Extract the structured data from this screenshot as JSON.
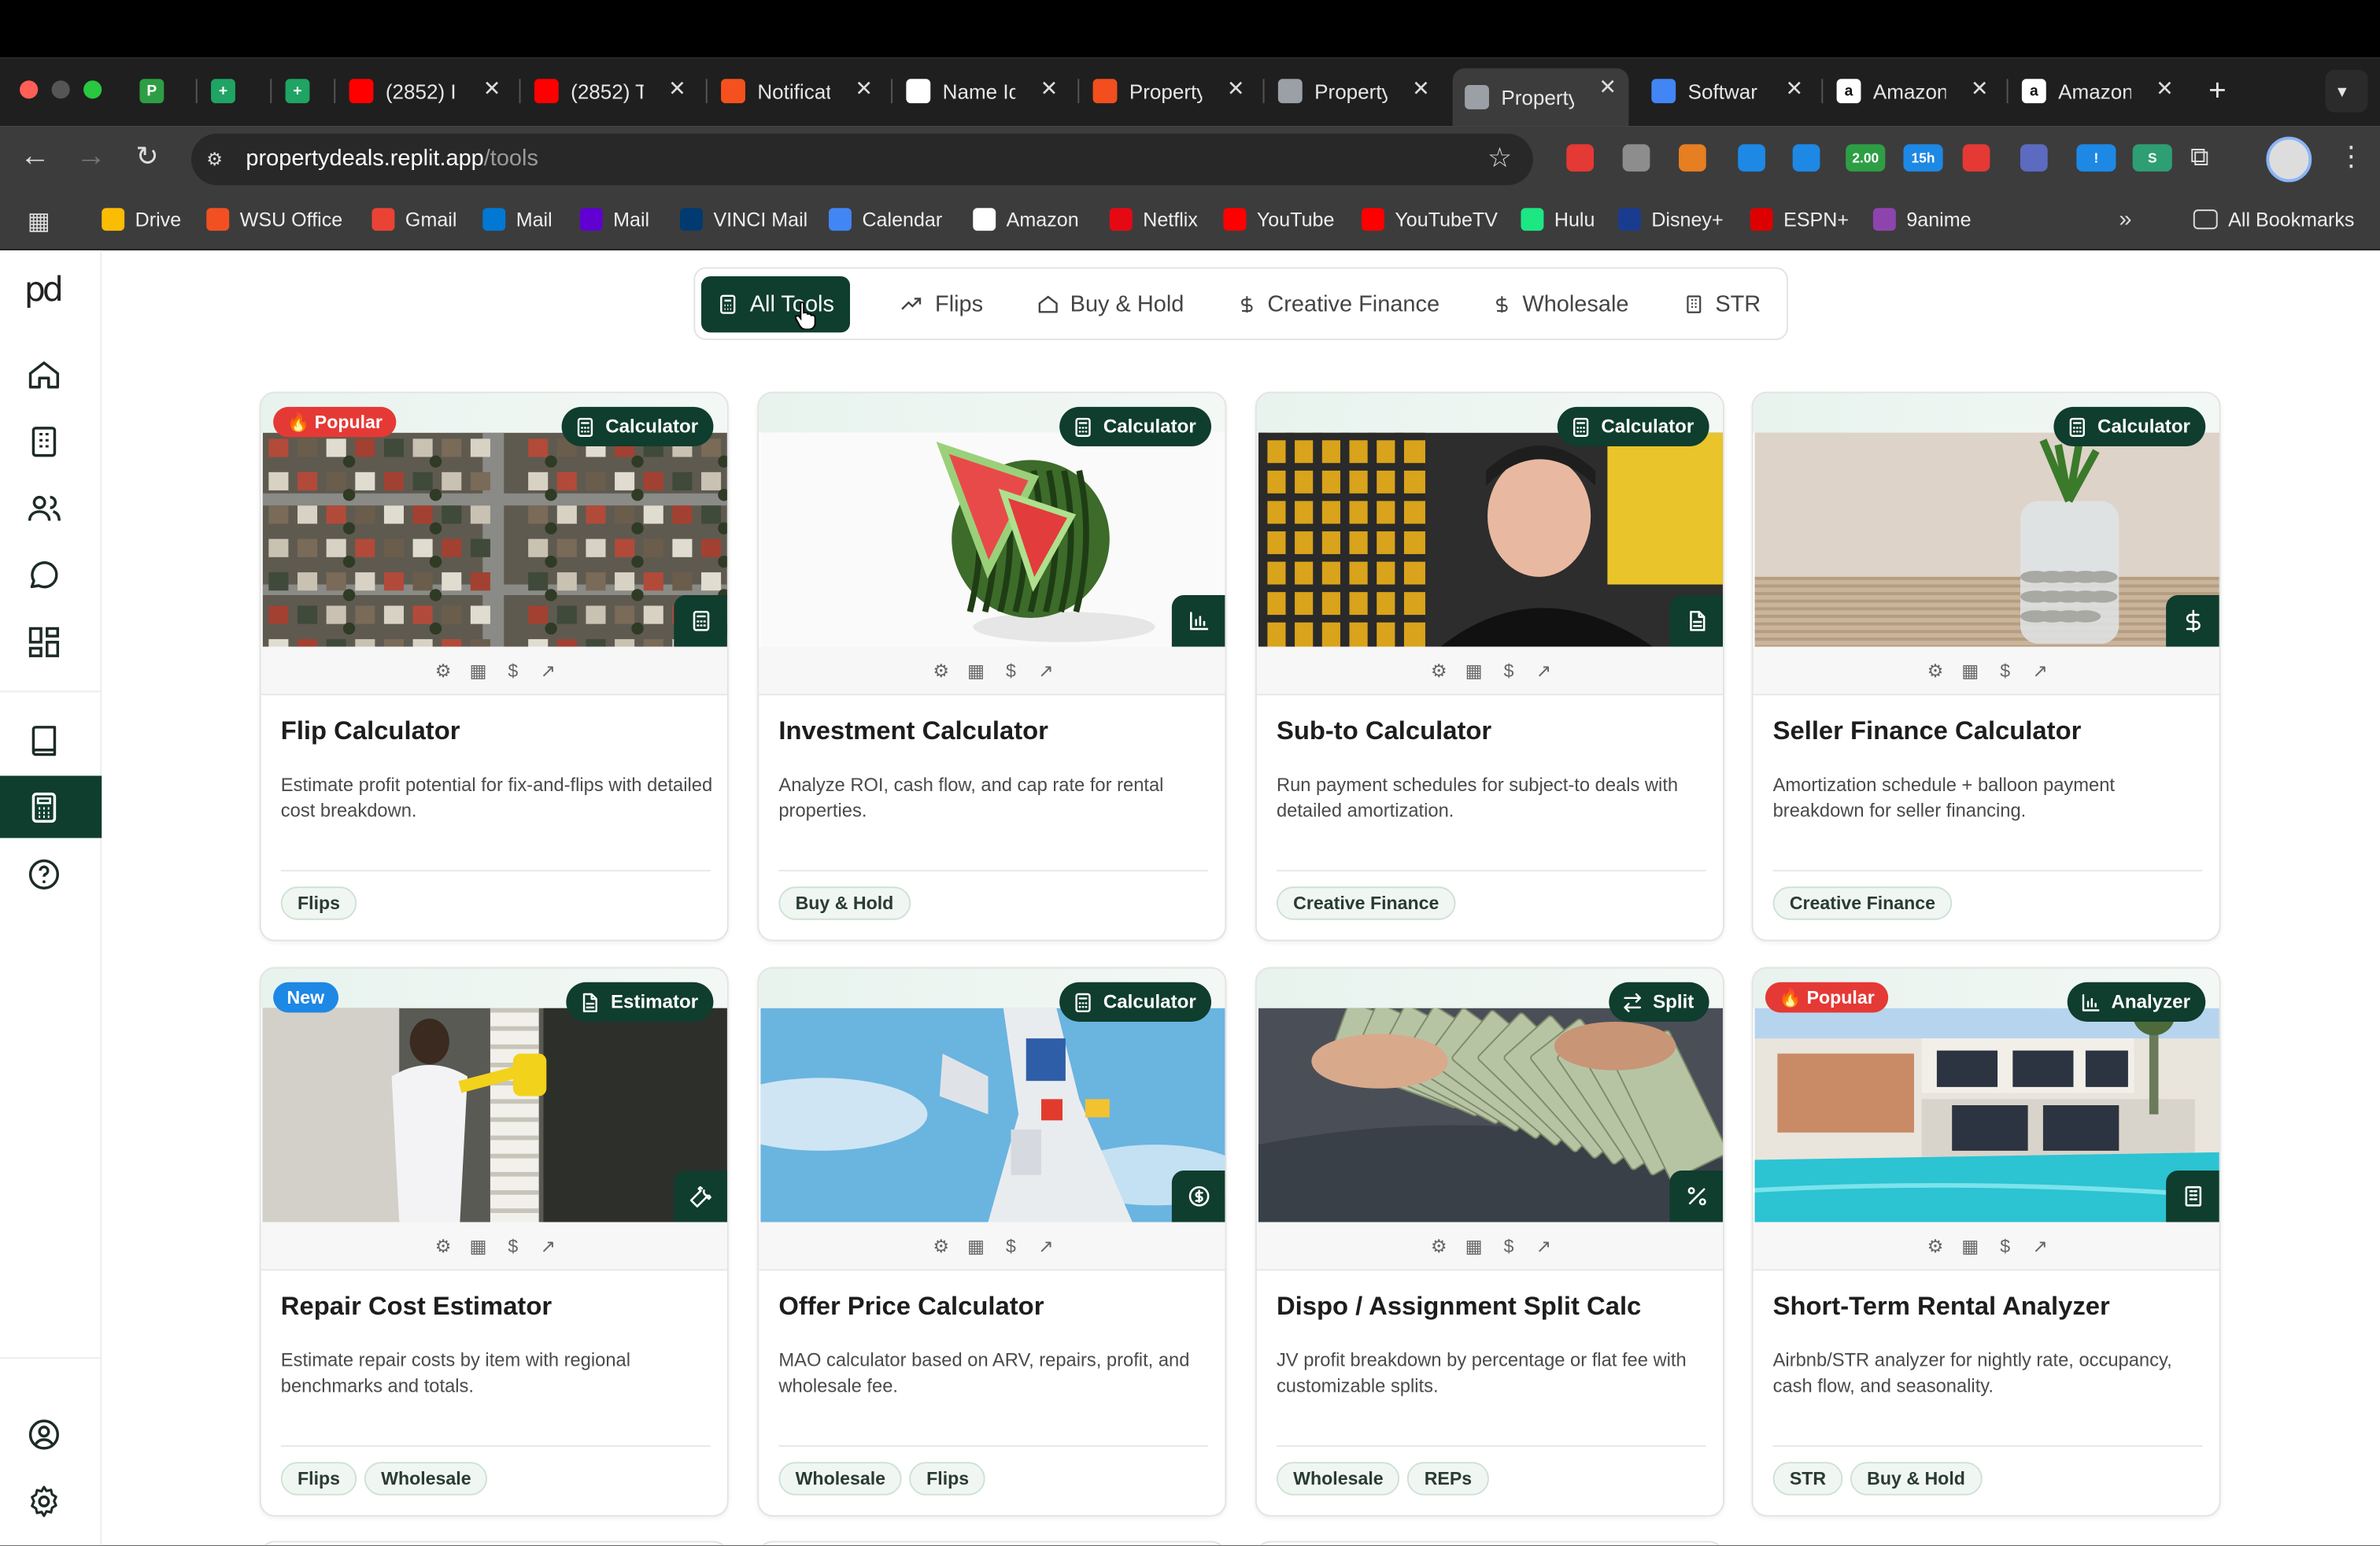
{
  "browser": {
    "tabs": [
      {
        "label": "",
        "favicon": "P",
        "color": "#2e9e44"
      },
      {
        "label": "",
        "favicon": "+",
        "color": "#1fa463"
      },
      {
        "label": "",
        "favicon": "+",
        "color": "#1fa463"
      },
      {
        "label": "(2852) I",
        "favicon": "youtube-icon",
        "color": "#ff0000"
      },
      {
        "label": "(2852) T",
        "favicon": "youtube-icon",
        "color": "#ff0000"
      },
      {
        "label": "Notificat",
        "favicon": "bell-icon",
        "color": "#f4511e"
      },
      {
        "label": "Name Id",
        "favicon": "openai-icon",
        "color": "#ffffff"
      },
      {
        "label": "Property",
        "favicon": "figma-icon",
        "color": "#f24e1e"
      },
      {
        "label": "Property",
        "favicon": "globe-icon",
        "color": "#9aa0a6"
      },
      {
        "label": "Property",
        "favicon": "globe-icon",
        "color": "#9aa0a6"
      },
      {
        "label": "Softwar",
        "favicon": "docs-icon",
        "color": "#4285f4"
      },
      {
        "label": "Amazon",
        "favicon": "a",
        "color": "#ffffff"
      },
      {
        "label": "Amazon",
        "favicon": "a",
        "color": "#ffffff"
      }
    ],
    "url_host": "propertydeals.replit.app",
    "url_path": "/tools",
    "extensions": [
      {
        "label": "",
        "color": "#e53935"
      },
      {
        "label": "",
        "color": "#8d8d8d"
      },
      {
        "label": "",
        "color": "#e67e22"
      },
      {
        "label": "",
        "color": "#1e88e5"
      },
      {
        "label": "",
        "color": "#1e88e5"
      },
      {
        "label": "2.00",
        "color": "#2e9e44"
      },
      {
        "label": "15h",
        "color": "#1e88e5"
      },
      {
        "label": "",
        "color": "#e53935"
      },
      {
        "label": "",
        "color": "#5c6bc0"
      },
      {
        "label": "!",
        "color": "#1e88e5"
      },
      {
        "label": "S",
        "color": "#2e9e74"
      }
    ],
    "bookmarks": [
      {
        "label": "Drive",
        "icon": "drive-icon",
        "color": "#fbbc04"
      },
      {
        "label": "WSU Office",
        "icon": "office-icon",
        "color": "#f25022"
      },
      {
        "label": "Gmail",
        "icon": "gmail-icon",
        "color": "#ea4335"
      },
      {
        "label": "Mail",
        "icon": "outlook-icon",
        "color": "#0078d4"
      },
      {
        "label": "Mail",
        "icon": "yahoo-icon",
        "color": "#6001d2"
      },
      {
        "label": "VINCI Mail",
        "icon": "vinci-icon",
        "color": "#003a70"
      },
      {
        "label": "Calendar",
        "icon": "calendar-icon",
        "color": "#4285f4"
      },
      {
        "label": "Amazon",
        "icon": "amazon-icon",
        "color": "#ffffff"
      },
      {
        "label": "Netflix",
        "icon": "netflix-icon",
        "color": "#e50914"
      },
      {
        "label": "YouTube",
        "icon": "youtube-icon",
        "color": "#ff0000"
      },
      {
        "label": "YouTubeTV",
        "icon": "youtubetv-icon",
        "color": "#ff0000"
      },
      {
        "label": "Hulu",
        "icon": "hulu-icon",
        "color": "#1ce783"
      },
      {
        "label": "Disney+",
        "icon": "disney-icon",
        "color": "#1a3c8f"
      },
      {
        "label": "ESPN+",
        "icon": "espn-icon",
        "color": "#d00"
      },
      {
        "label": "9anime",
        "icon": "anime-icon",
        "color": "#8e44ad"
      }
    ],
    "all_bookmarks": "All Bookmarks"
  },
  "app": {
    "logo": "pd",
    "filters": [
      {
        "label": "All Tools",
        "icon": "calculator-icon"
      },
      {
        "label": "Flips",
        "icon": "trend-icon"
      },
      {
        "label": "Buy & Hold",
        "icon": "home-icon"
      },
      {
        "label": "Creative Finance",
        "icon": "dollar-icon"
      },
      {
        "label": "Wholesale",
        "icon": "dollar-icon"
      },
      {
        "label": "STR",
        "icon": "building-icon"
      }
    ],
    "strip_icons": [
      "⚙",
      "▦",
      "$",
      "↗"
    ],
    "cards": [
      {
        "title": "Flip Calculator",
        "desc": "Estimate profit potential for fix-and-flips with detailed cost breakdown.",
        "pill": "Calculator",
        "pill_icon": "calculator-icon",
        "badge": "🔥 Popular",
        "badge_type": "popular",
        "corner_icon": "calculator-icon",
        "tags": [
          "Flips"
        ],
        "image": "aerial-neighborhood"
      },
      {
        "title": "Investment Calculator",
        "desc": "Analyze ROI, cash flow, and cap rate for rental properties.",
        "pill": "Calculator",
        "pill_icon": "calculator-icon",
        "badge": "",
        "badge_type": "",
        "corner_icon": "bar-chart-icon",
        "tags": [
          "Buy & Hold"
        ],
        "image": "watermelon"
      },
      {
        "title": "Sub-to Calculator",
        "desc": "Run payment schedules for subject-to deals with detailed amortization.",
        "pill": "Calculator",
        "pill_icon": "calculator-icon",
        "badge": "",
        "badge_type": "",
        "corner_icon": "document-icon",
        "tags": [
          "Creative Finance"
        ],
        "image": "smiling-man"
      },
      {
        "title": "Seller Finance Calculator",
        "desc": "Amortization schedule + balloon payment breakdown for seller financing.",
        "pill": "Calculator",
        "pill_icon": "calculator-icon",
        "badge": "",
        "badge_type": "",
        "corner_icon": "dollar-icon",
        "tags": [
          "Creative Finance"
        ],
        "image": "coin-jar"
      },
      {
        "title": "Repair Cost Estimator",
        "desc": "Estimate repair costs by item with regional benchmarks and totals.",
        "pill": "Estimator",
        "pill_icon": "document-icon",
        "badge": "New",
        "badge_type": "new",
        "corner_icon": "wrench-icon",
        "tags": [
          "Flips",
          "Wholesale"
        ],
        "image": "cleaning-window"
      },
      {
        "title": "Offer Price Calculator",
        "desc": "MAO calculator based on ARV, repairs, profit, and wholesale fee.",
        "pill": "Calculator",
        "pill_icon": "calculator-icon",
        "badge": "",
        "badge_type": "",
        "corner_icon": "coin-icon",
        "tags": [
          "Wholesale",
          "Flips"
        ],
        "image": "robot-statue"
      },
      {
        "title": "Dispo / Assignment Split Calc",
        "desc": "JV profit breakdown by percentage or flat fee with customizable splits.",
        "pill": "Split",
        "pill_icon": "swap-icon",
        "badge": "",
        "badge_type": "",
        "corner_icon": "percent-icon",
        "tags": [
          "Wholesale",
          "REPs"
        ],
        "image": "cash-hands"
      },
      {
        "title": "Short-Term Rental Analyzer",
        "desc": "Airbnb/STR analyzer for nightly rate, occupancy, cash flow, and seasonality.",
        "pill": "Analyzer",
        "pill_icon": "bar-chart-icon",
        "badge": "🔥 Popular",
        "badge_type": "popular",
        "corner_icon": "building-icon",
        "tags": [
          "STR",
          "Buy & Hold"
        ],
        "image": "modern-house-pool"
      }
    ]
  }
}
